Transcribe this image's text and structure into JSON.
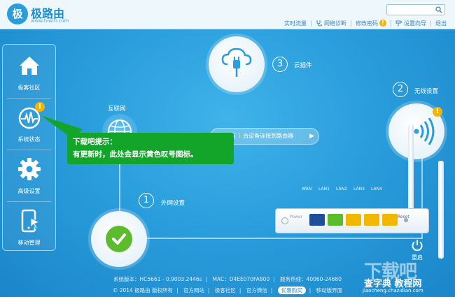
{
  "header": {
    "logo_name": "极路由",
    "logo_url": "www.hiwifi.com",
    "logo_mark": "极",
    "search_placeholder": "",
    "nav": [
      {
        "label": "实时流量"
      },
      {
        "label": "网络诊断"
      },
      {
        "label": "修改密码"
      },
      {
        "label": "设置向导"
      },
      {
        "label": "退出"
      }
    ],
    "warn_mark": "!"
  },
  "sidebar": {
    "items": [
      {
        "label": "极客社区",
        "icon": "home-icon"
      },
      {
        "label": "系统状态",
        "icon": "pulse-icon",
        "badge": "!"
      },
      {
        "label": "高级设置",
        "icon": "gear-icon"
      },
      {
        "label": "移动管理",
        "icon": "mobile-icon"
      }
    ]
  },
  "map": {
    "internet_label": "互联网",
    "cloud_num": "3",
    "cloud_label": "云插件",
    "wifi_num": "2",
    "wifi_label": "无线设置",
    "wan_num": "1",
    "wan_label": "外网设置",
    "wifi_badge": "!",
    "connect_prefix": "有",
    "connect_count": "1",
    "connect_suffix": "台设备连接到路由器",
    "connect_arrow": "▶"
  },
  "router": {
    "ports": [
      "WAN",
      "LAN1",
      "LAN2",
      "LAN3",
      "LAN4"
    ],
    "power_label": "Power",
    "reset_label": "Reset",
    "reboot_label": "重启"
  },
  "tooltip": {
    "title": "下载吧提示：",
    "text": "有更新时，此处会显示黄色叹号图标。"
  },
  "footer": {
    "system_version": "系统版本：HC5661 - 0.9003.2446s",
    "mac": "MAC：D4EE070FA800",
    "hotline": "服务热线：40060-24680",
    "copyright": "© 2014 极路由 版权所有",
    "links": [
      "官方网站",
      "极客社区",
      "官方微信"
    ],
    "deal": "优惠购买",
    "mobile": "移动版界面"
  },
  "watermark": {
    "big": "下载吧",
    "mid": "查字典 教程网",
    "url": "jiaocheng.chazidian.com"
  },
  "colors": {
    "background": "#2a9ddc",
    "tooltip": "#12a52a",
    "warning": "#f4b400",
    "wan_port": "#1f4f9a",
    "lan1_port": "#5dbb2e",
    "lan_port": "#f2b800",
    "status_ok": "#5dbb2e"
  }
}
